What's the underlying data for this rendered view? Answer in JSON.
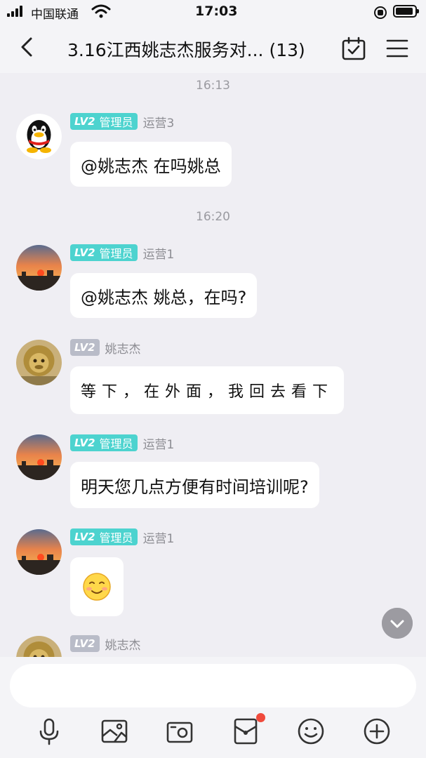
{
  "status_bar": {
    "carrier": "中国联通",
    "time": "17:03"
  },
  "header": {
    "title": "3.16江西姚志杰服务对... (13)"
  },
  "colors": {
    "admin_badge": "#4dd3cf",
    "member_badge": "#b9bcc8",
    "bubble": "#ffffff",
    "background": "#efeef3",
    "notification_dot": "#f04a3c"
  },
  "messages": [
    {
      "timestamp": "16:13"
    },
    {
      "level": "LV2",
      "role": "管理员",
      "sender": "运营3",
      "avatar": "qq-penguin-avatar",
      "text": "@姚志杰 在吗姚总"
    },
    {
      "timestamp": "16:20"
    },
    {
      "level": "LV2",
      "role": "管理员",
      "sender": "运营1",
      "avatar": "sunset-avatar",
      "text": "@姚志杰 姚总，在吗?"
    },
    {
      "level": "LV2",
      "role": "",
      "sender": "姚志杰",
      "avatar": "golden-monkey-avatar",
      "text": "等下，在外面，我回去看下"
    },
    {
      "level": "LV2",
      "role": "管理员",
      "sender": "运营1",
      "avatar": "sunset-avatar",
      "text": "明天您几点方便有时间培训呢?"
    },
    {
      "level": "LV2",
      "role": "管理员",
      "sender": "运营1",
      "avatar": "sunset-avatar",
      "emoji": "smile-emoji-icon"
    },
    {
      "level": "LV2",
      "role": "",
      "sender": "姚志杰",
      "avatar": "golden-monkey-avatar"
    }
  ],
  "input": {
    "value": "",
    "placeholder": ""
  },
  "toolbar": [
    "microphone-icon",
    "image-icon",
    "camera-icon",
    "red-packet-icon",
    "emoji-icon",
    "plus-icon"
  ]
}
